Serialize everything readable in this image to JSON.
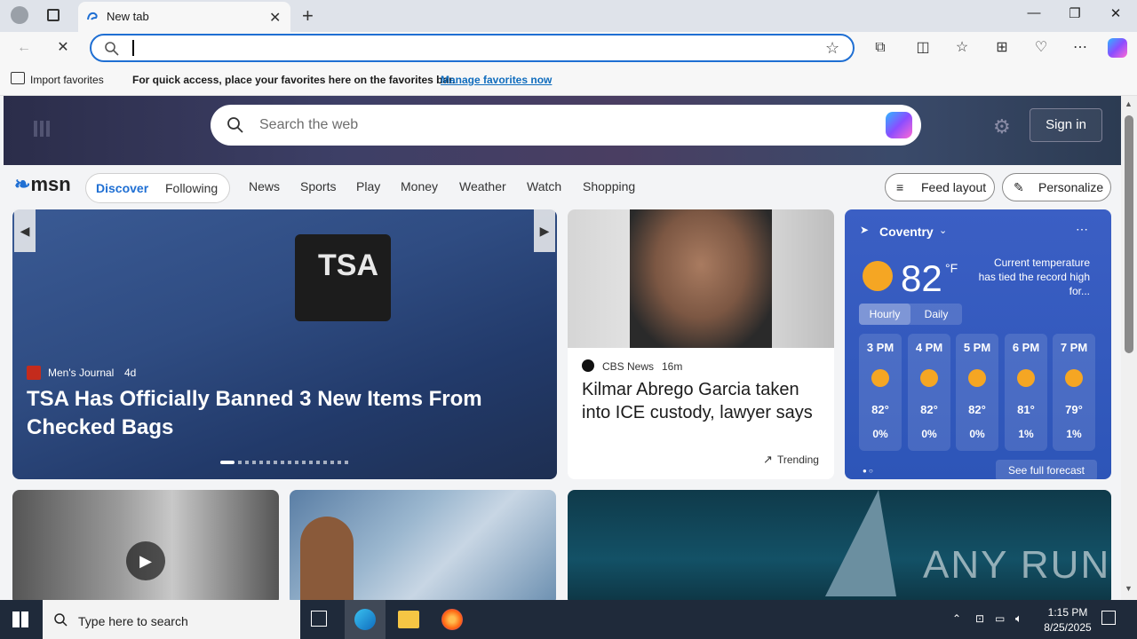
{
  "browser": {
    "tab_title": "New tab",
    "address_value": "",
    "favorites_bar": {
      "import_label": "Import favorites",
      "message": "For quick access, place your favorites here on the favorites bar.",
      "manage_link": "Manage favorites now"
    }
  },
  "msn": {
    "search_placeholder": "Search the web",
    "sign_in": "Sign in",
    "logo": "msn",
    "tabs": [
      "Discover",
      "Following"
    ],
    "nav": [
      "News",
      "Sports",
      "Play",
      "Money",
      "Weather",
      "Watch",
      "Shopping"
    ],
    "feed_layout": "Feed layout",
    "personalize": "Personalize",
    "main_story": {
      "source": "Men's Journal",
      "age": "4d",
      "headline": "TSA Has Officially Banned 3 New Items From Checked Bags"
    },
    "news_story": {
      "source": "CBS News",
      "age": "16m",
      "headline": "Kilmar Abrego Garcia taken into ICE custody, lawyer says",
      "trending": "Trending"
    },
    "weather": {
      "location": "Coventry",
      "temp": "82",
      "unit": "°F",
      "alert": "Current temperature has tied the record high for...",
      "tabs": [
        "Hourly",
        "Daily"
      ],
      "hours": [
        {
          "time": "3 PM",
          "temp": "82°",
          "precip": "0%"
        },
        {
          "time": "4 PM",
          "temp": "82°",
          "precip": "0%"
        },
        {
          "time": "5 PM",
          "temp": "82°",
          "precip": "0%"
        },
        {
          "time": "6 PM",
          "temp": "81°",
          "precip": "1%"
        },
        {
          "time": "7 PM",
          "temp": "79°",
          "precip": "1%"
        }
      ],
      "full_forecast": "See full forecast"
    },
    "watermark": "ANY RUN"
  },
  "taskbar": {
    "search_placeholder": "Type here to search",
    "time": "1:15 PM",
    "date": "8/25/2025"
  },
  "colors": {
    "accent": "#1f6fd3",
    "link": "#0f6cbd",
    "weather_bg": "#3b5fc4"
  }
}
